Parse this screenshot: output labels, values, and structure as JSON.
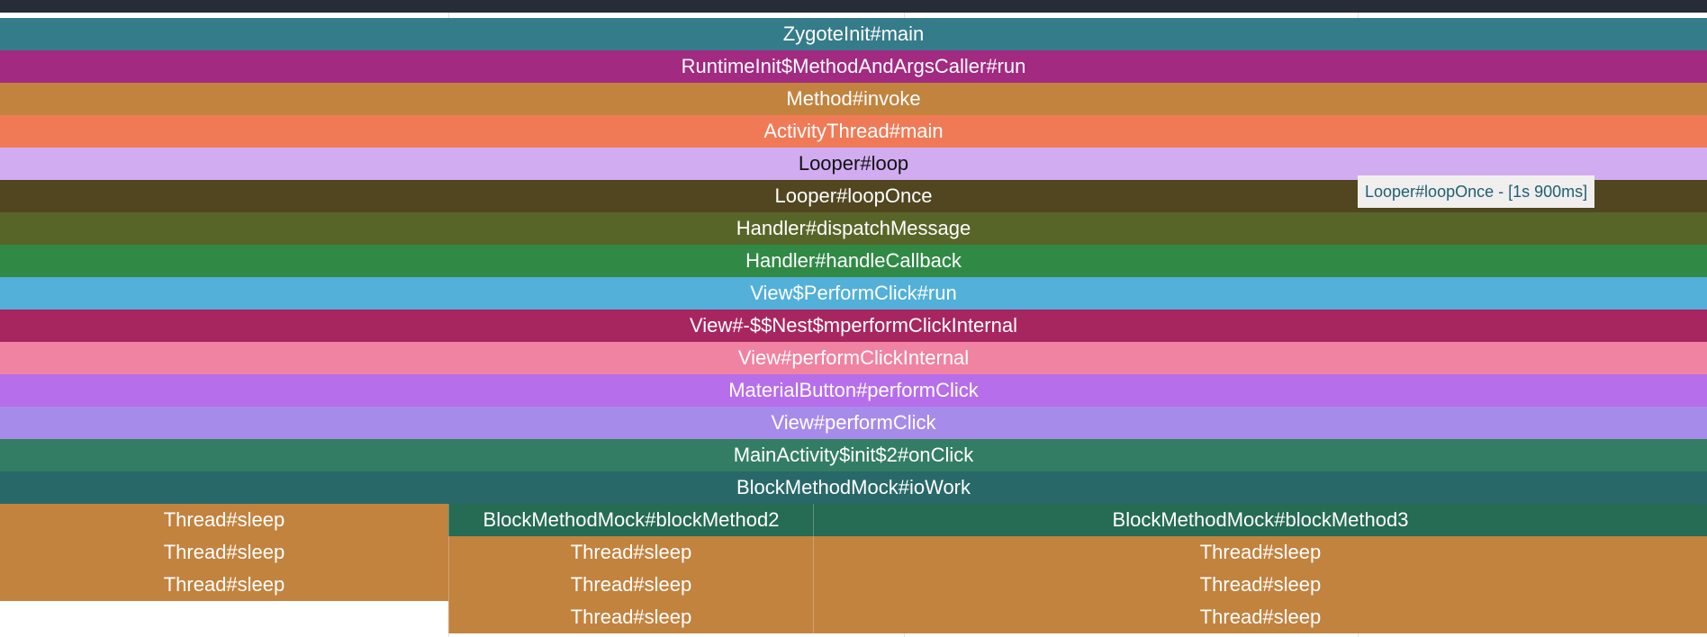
{
  "colors": {
    "top_bar": "#262d38",
    "tooltip_bg": "#f0efee",
    "tooltip_text": "#1f5f73"
  },
  "tooltip": {
    "text": "Looper#loopOnce - [1s 900ms]"
  },
  "frames": [
    {
      "label": "ZygoteInit#main",
      "color": "#357c8a",
      "text": "#ffffff"
    },
    {
      "label": "RuntimeInit$MethodAndArgsCaller#run",
      "color": "#a22a81",
      "text": "#ffffff"
    },
    {
      "label": "Method#invoke",
      "color": "#c2833f",
      "text": "#ffffff"
    },
    {
      "label": "ActivityThread#main",
      "color": "#f07a56",
      "text": "#ffffff"
    },
    {
      "label": "Looper#loop",
      "color": "#d1acf0",
      "text": "#111111"
    },
    {
      "label": "Looper#loopOnce",
      "color": "#514620",
      "text": "#ffffff"
    },
    {
      "label": "Handler#dispatchMessage",
      "color": "#586528",
      "text": "#ffffff"
    },
    {
      "label": "Handler#handleCallback",
      "color": "#308a46",
      "text": "#ffffff"
    },
    {
      "label": "View$PerformClick#run",
      "color": "#52b0d9",
      "text": "#ffffff"
    },
    {
      "label": "View#-$$Nest$mperformClickInternal",
      "color": "#a82660",
      "text": "#ffffff"
    },
    {
      "label": "View#performClickInternal",
      "color": "#f083a1",
      "text": "#ffffff"
    },
    {
      "label": "MaterialButton#performClick",
      "color": "#b76eea",
      "text": "#ffffff"
    },
    {
      "label": "View#performClick",
      "color": "#a78bea",
      "text": "#ffffff"
    },
    {
      "label": "MainActivity$init$2#onClick",
      "color": "#337d64",
      "text": "#ffffff"
    },
    {
      "label": "BlockMethodMock#ioWork",
      "color": "#296868",
      "text": "#ffffff"
    },
    {
      "label": "Thread#sleep",
      "color": "#c2833f",
      "text": "#ffffff"
    },
    {
      "label": "Thread#sleep",
      "color": "#c2833f",
      "text": "#ffffff"
    },
    {
      "label": "Thread#sleep",
      "color": "#c2833f",
      "text": "#ffffff"
    },
    {
      "label": "BlockMethodMock#blockMethod2",
      "color": "#266b53",
      "text": "#ffffff"
    },
    {
      "label": "Thread#sleep",
      "color": "#c2833f",
      "text": "#ffffff"
    },
    {
      "label": "Thread#sleep",
      "color": "#c2833f",
      "text": "#ffffff"
    },
    {
      "label": "Thread#sleep",
      "color": "#c2833f",
      "text": "#ffffff"
    },
    {
      "label": "BlockMethodMock#blockMethod3",
      "color": "#266b53",
      "text": "#ffffff"
    },
    {
      "label": "Thread#sleep",
      "color": "#c2833f",
      "text": "#ffffff"
    },
    {
      "label": "Thread#sleep",
      "color": "#c2833f",
      "text": "#ffffff"
    },
    {
      "label": "Thread#sleep",
      "color": "#c2833f",
      "text": "#ffffff"
    }
  ]
}
